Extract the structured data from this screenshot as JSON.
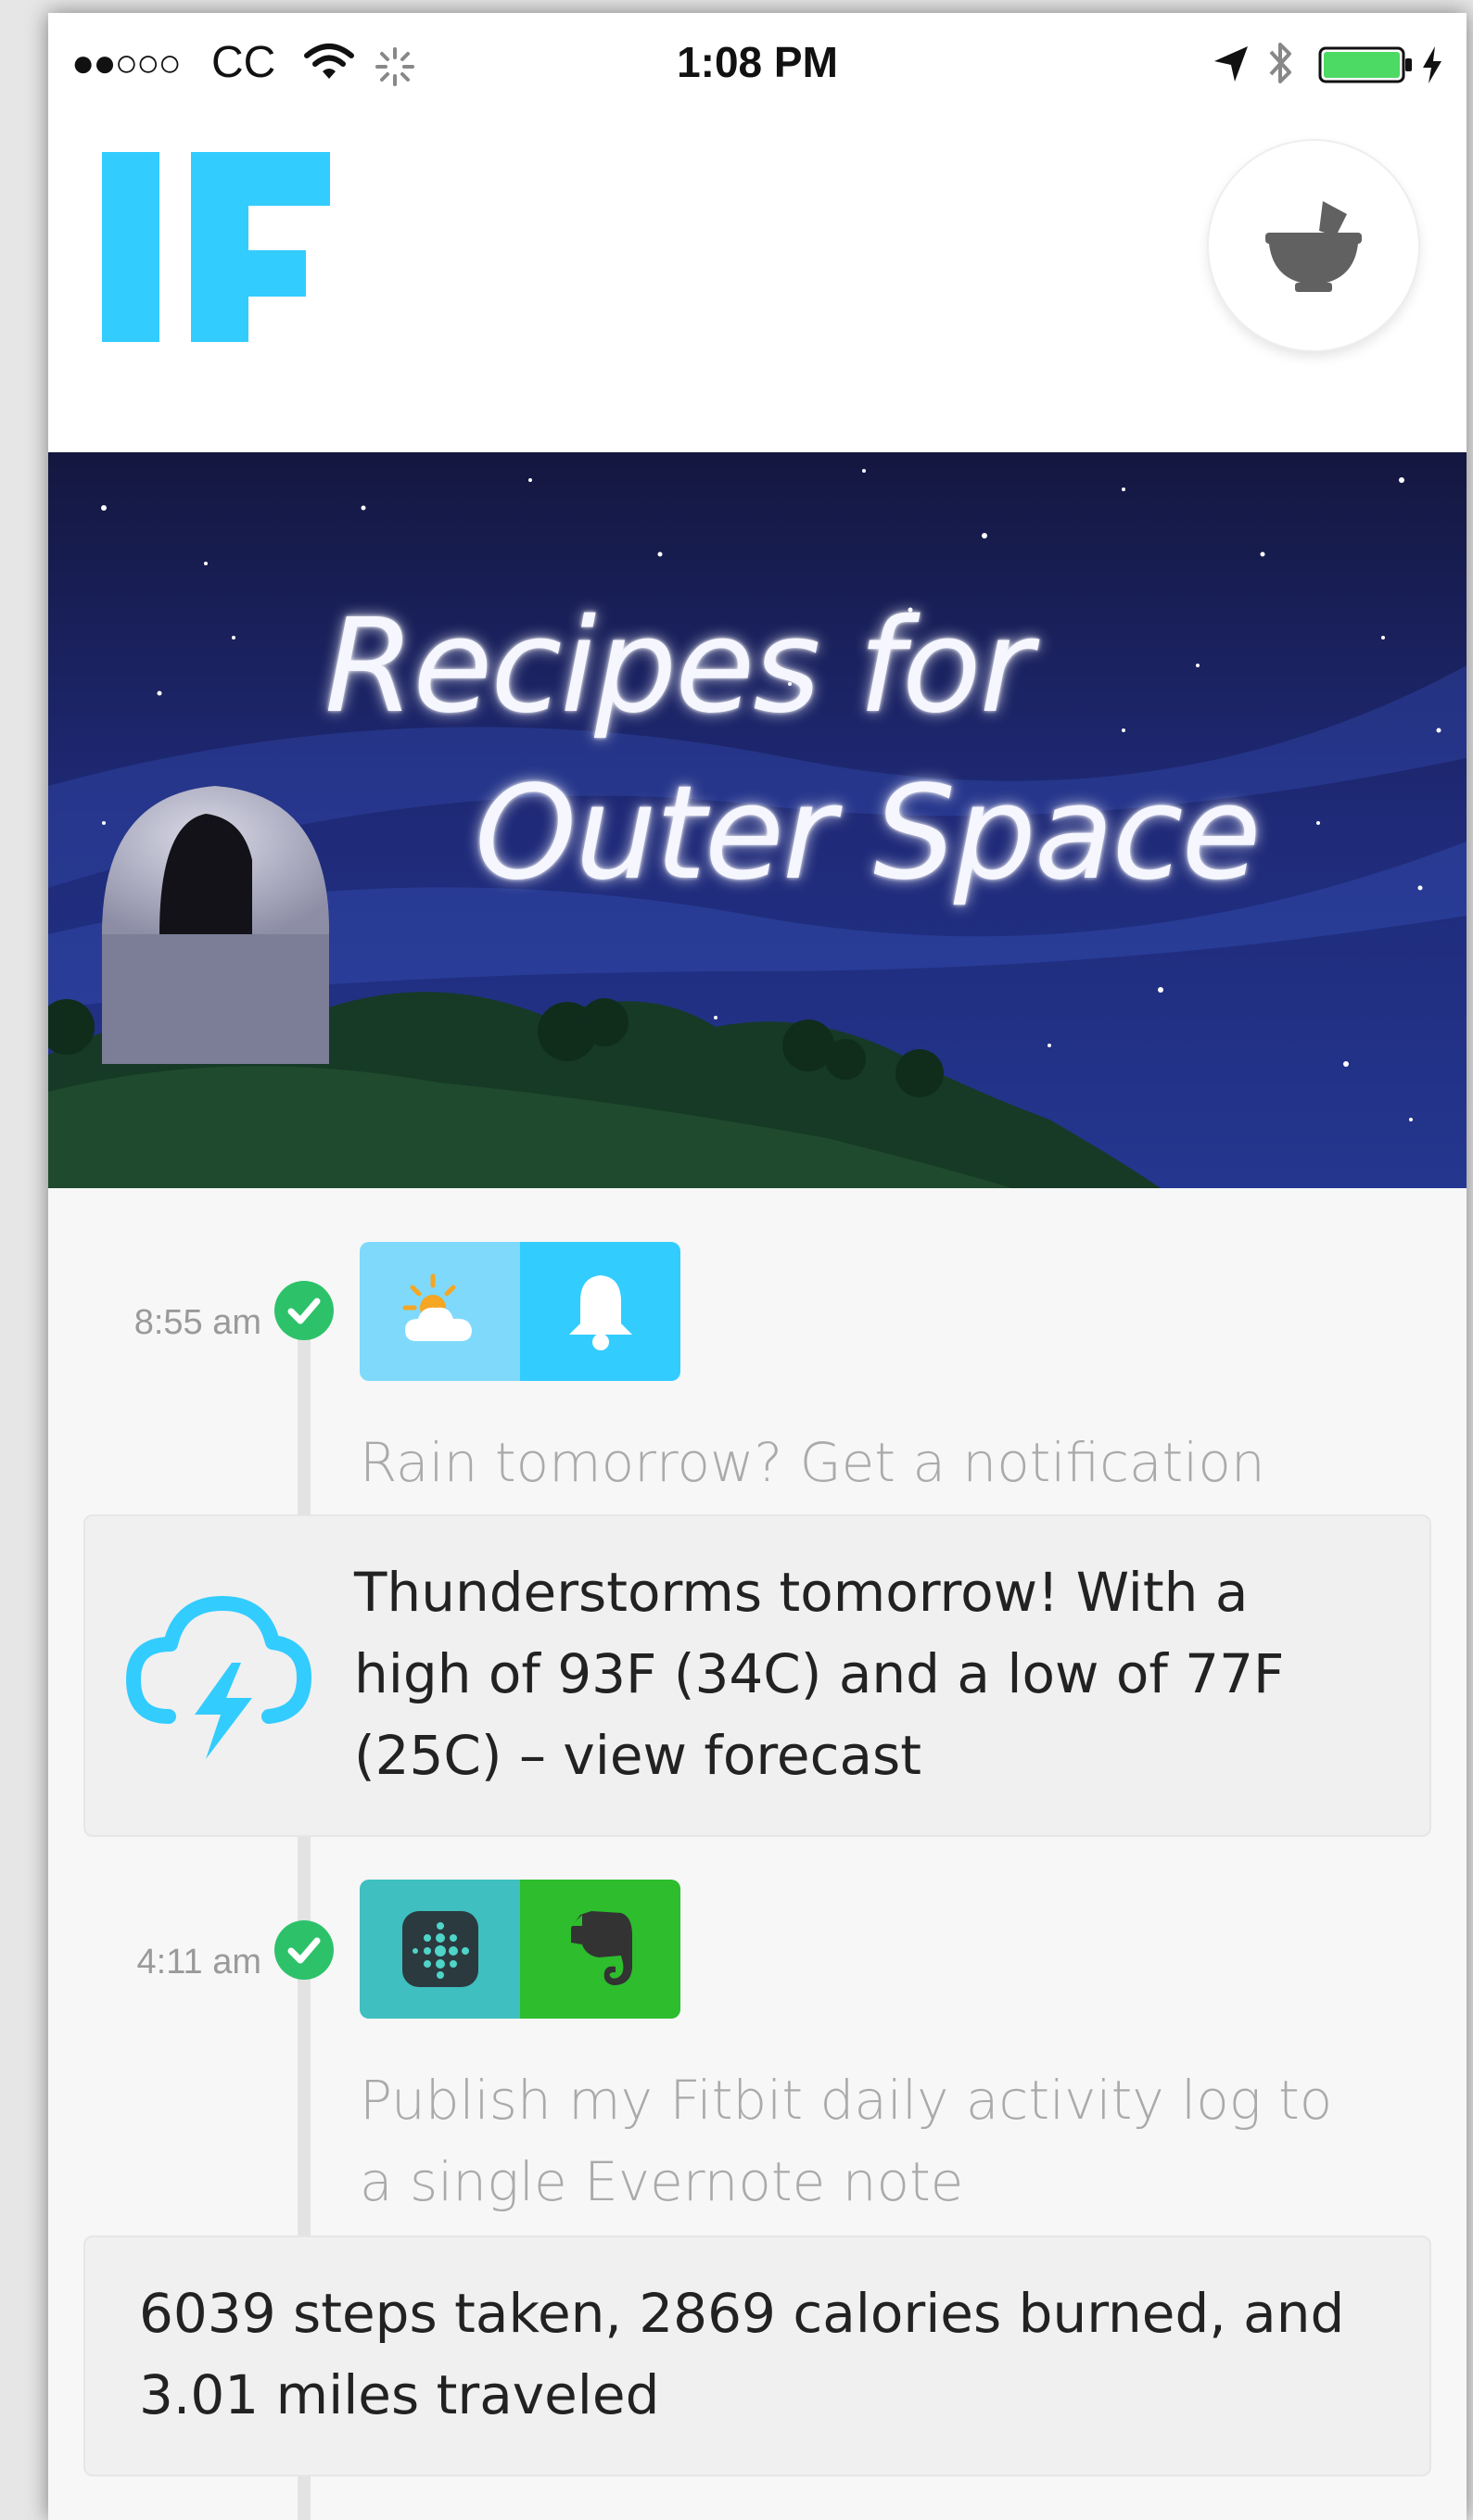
{
  "status_bar": {
    "signal": "●●○○○",
    "carrier": "CC",
    "time": "1:08 PM"
  },
  "header": {
    "logo_text": "IF",
    "logo_color": "#33ccff",
    "maker_button_icon": "mortar-pestle-icon"
  },
  "banner": {
    "line1": "Recipes for",
    "line2": "Outer Space"
  },
  "feed": [
    {
      "time": "8:55 am",
      "status": "success",
      "trigger_icon": "weather-partly-cloudy-icon",
      "action_icon": "bell-icon",
      "trigger_color": "#7fd9fb",
      "action_color": "#33ccff",
      "title": "Rain tomorrow? Get a notification",
      "card_icon": "thunderstorm-icon",
      "card_text": [
        "Thunderstorms tomorrow! With a",
        "high of 93F (34C) and a low of 77F",
        "(25C) – view forecast"
      ]
    },
    {
      "time": "4:11 am",
      "status": "success",
      "trigger_icon": "fitbit-icon",
      "action_icon": "evernote-elephant-icon",
      "trigger_color": "#3fbfbf",
      "action_color": "#2dbd2d",
      "title": [
        "Publish my Fitbit daily activity log to",
        "a single Evernote note"
      ],
      "card_text": [
        "6039 steps taken, 2869 calories burned, and",
        "3.01 miles traveled"
      ]
    }
  ]
}
